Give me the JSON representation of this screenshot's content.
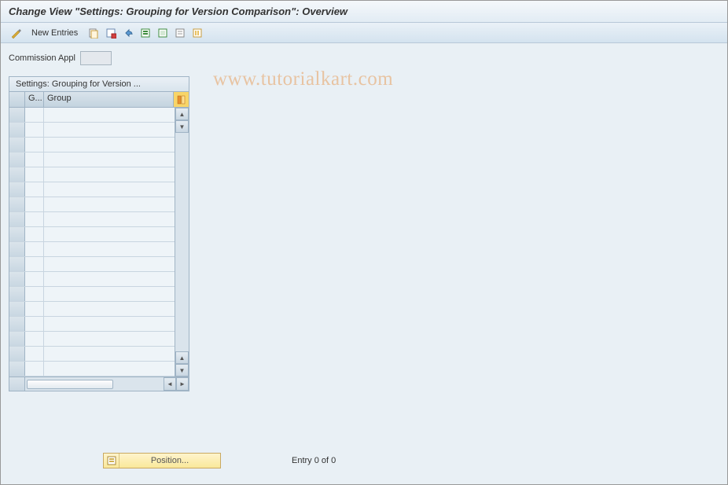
{
  "title": "Change View \"Settings: Grouping for Version Comparison\": Overview",
  "toolbar": {
    "new_entries": "New Entries"
  },
  "fields": {
    "commission_label": "Commission Appl",
    "commission_value": ""
  },
  "table": {
    "title": "Settings: Grouping for Version ...",
    "col1": "G...",
    "col2": "Group",
    "row_count": 18
  },
  "footer": {
    "position_label": "Position...",
    "entry_text": "Entry 0 of 0"
  },
  "watermark": "www.tutorialkart.com"
}
